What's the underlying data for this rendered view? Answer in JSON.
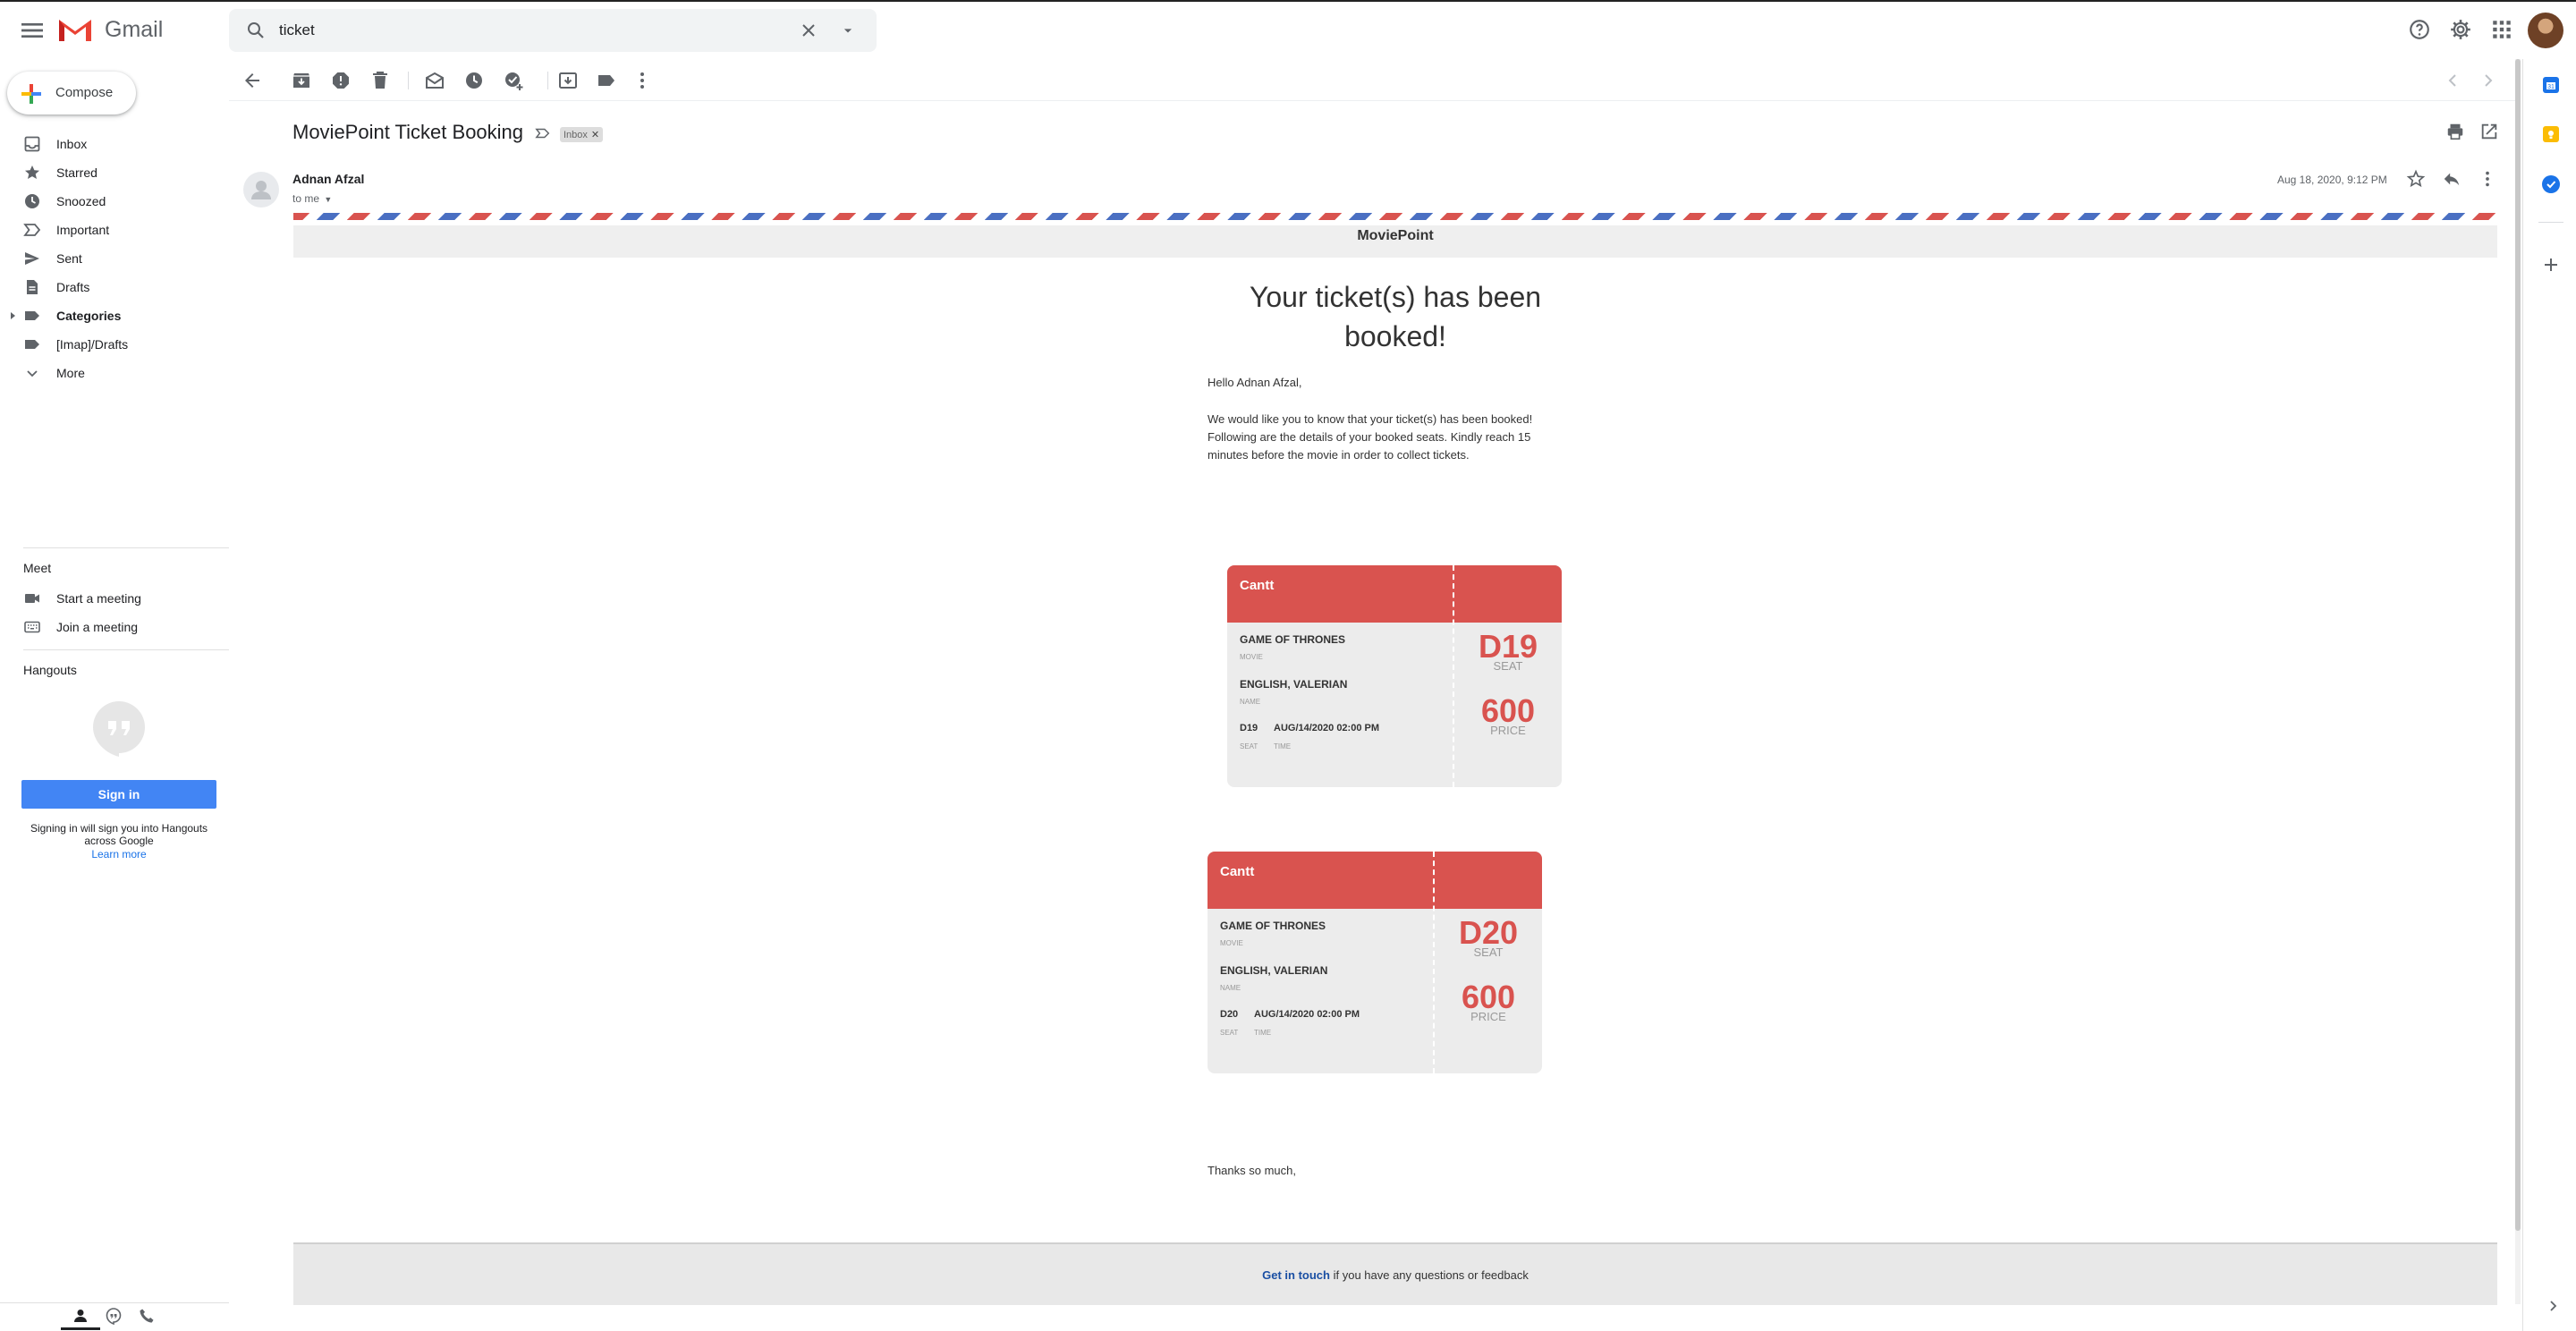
{
  "app": {
    "name": "Gmail"
  },
  "search": {
    "value": "ticket"
  },
  "sidebar": {
    "compose_label": "Compose",
    "items": [
      {
        "label": "Inbox",
        "icon": "inbox-icon"
      },
      {
        "label": "Starred",
        "icon": "star-icon"
      },
      {
        "label": "Snoozed",
        "icon": "clock-icon"
      },
      {
        "label": "Important",
        "icon": "important-icon"
      },
      {
        "label": "Sent",
        "icon": "send-icon"
      },
      {
        "label": "Drafts",
        "icon": "draft-icon"
      },
      {
        "label": "Categories",
        "icon": "label-icon"
      },
      {
        "label": "[Imap]/Drafts",
        "icon": "label-icon"
      },
      {
        "label": "More",
        "icon": "chevron-down-icon"
      }
    ]
  },
  "meet": {
    "title": "Meet",
    "start_label": "Start a meeting",
    "join_label": "Join a meeting"
  },
  "hangouts": {
    "title": "Hangouts",
    "signin_label": "Sign in",
    "note": "Signing in will sign you into Hangouts across Google",
    "learn_more": "Learn more"
  },
  "email": {
    "subject": "MoviePoint Ticket Booking",
    "label_chip": "Inbox",
    "sender": "Adnan Afzal",
    "to": "to me",
    "date": "Aug 18, 2020, 9:12 PM",
    "brand": "MoviePoint",
    "headline": "Your ticket(s) has been booked!",
    "greeting": "Hello Adnan Afzal,",
    "intro": "We would like you to know that your ticket(s) has been booked! Following are the details of your booked seats. Kindly reach 15 minutes before the movie in order to collect tickets.",
    "tickets": [
      {
        "cinema": "Cantt",
        "movie": "GAME OF THRONES",
        "movie_caption": "MOVIE",
        "name": "ENGLISH, VALERIAN",
        "name_caption": "NAME",
        "seat": "D19",
        "time": "AUG/14/2020 02:00 PM",
        "seat_caption": "SEAT",
        "time_caption": "TIME",
        "price": "600",
        "price_caption": "PRICE"
      },
      {
        "cinema": "Cantt",
        "movie": "GAME OF THRONES",
        "movie_caption": "MOVIE",
        "name": "ENGLISH, VALERIAN",
        "name_caption": "NAME",
        "seat": "D20",
        "time": "AUG/14/2020 02:00 PM",
        "seat_caption": "SEAT",
        "time_caption": "TIME",
        "price": "600",
        "price_caption": "PRICE"
      }
    ],
    "thanks": "Thanks so much,",
    "footer_link": "Get in touch",
    "footer_text": " if you have any questions or feedback"
  },
  "colors": {
    "ticket_red": "#d9534f",
    "signin_blue": "#4285f4",
    "link_blue": "#1a4fa3"
  }
}
